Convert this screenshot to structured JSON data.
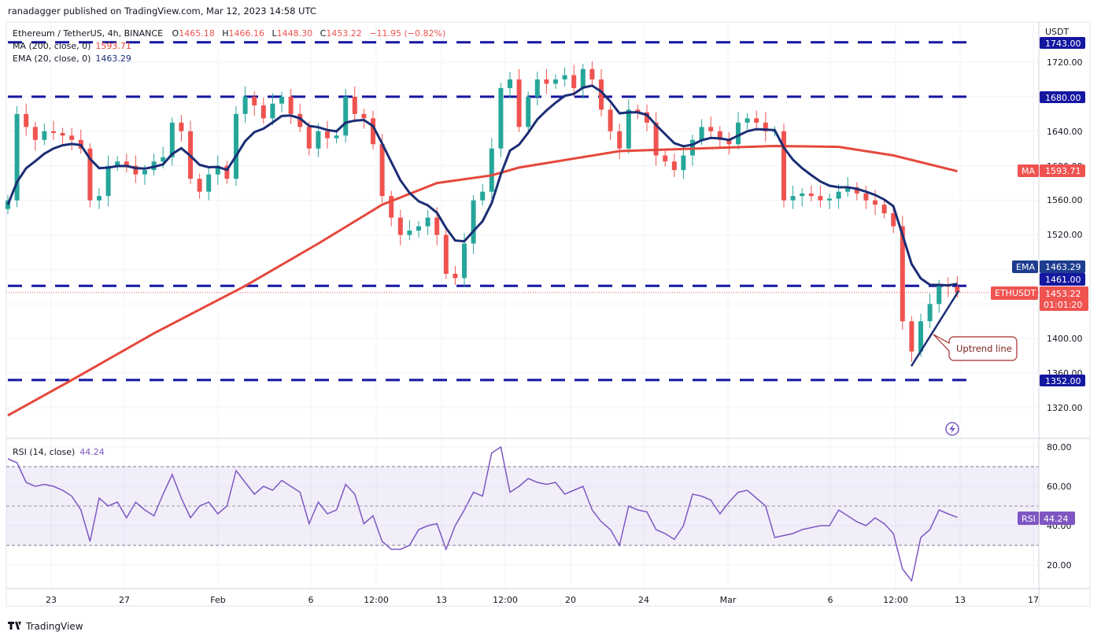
{
  "header": {
    "published": "ranadagger published on TradingView.com, Mar 12, 2023 14:58 UTC",
    "symbol": "Ethereum / TetherUS, 4h, BINANCE",
    "o_label": "O",
    "o": "1465.18",
    "h_label": "H",
    "h": "1466.16",
    "l_label": "L",
    "l": "1448.30",
    "c_label": "C",
    "c": "1453.22",
    "change": "−11.95 (−0.82%)",
    "ma_legend": "MA (200, close, 0)",
    "ma_value": "1593.71",
    "ema_legend": "EMA (20, close, 0)",
    "ema_value": "1463.29",
    "rsi_legend": "RSI (14, close)",
    "rsi_value": "44.24"
  },
  "price_axis": {
    "currency": "USDT",
    "ticks": [
      "1720.00",
      "1640.00",
      "1600.00",
      "1560.00",
      "1520.00",
      "1400.00",
      "1360.00",
      "1320.00"
    ],
    "badges": {
      "r1743": "1743.00",
      "r1680": "1680.00",
      "ma_tag": "MA",
      "ma": "1593.71",
      "ema_tag": "EMA",
      "ema": "1463.29",
      "r1461": "1461.00",
      "sym_tag": "ETHUSDT",
      "last": "1453.22",
      "countdown": "01:01:20",
      "r1352": "1352.00"
    }
  },
  "rsi_axis": {
    "ticks": [
      "80.00",
      "60.00",
      "40.00",
      "20.00"
    ],
    "tag": "RSI",
    "value": "44.24"
  },
  "time_axis": [
    "23",
    "27",
    "Feb",
    "6",
    "12:00",
    "13",
    "12:00",
    "20",
    "24",
    "Mar",
    "6",
    "12:00",
    "13",
    "17"
  ],
  "annotation": {
    "uptrend": "Uptrend line"
  },
  "footer": {
    "brand": "TradingView"
  },
  "colors": {
    "up": "#26a69a",
    "down": "#ef5350",
    "ma": "#e5483c",
    "ema": "#1b2e74",
    "level": "#1417a0",
    "rsi": "#7e57c2"
  },
  "chart_data": {
    "type": "candlestick",
    "title": "Ethereum / TetherUS, 4h, BINANCE",
    "sampling": "approx. 12h steps, Jan 20 to Mar 12 2023",
    "ylim": [
      1300,
      1760
    ],
    "horizontal_levels": [
      1743,
      1680,
      1461,
      1352
    ],
    "closes": [
      1560,
      1660,
      1645,
      1630,
      1640,
      1638,
      1635,
      1630,
      1620,
      1560,
      1565,
      1600,
      1605,
      1600,
      1590,
      1595,
      1605,
      1610,
      1650,
      1640,
      1585,
      1570,
      1590,
      1600,
      1585,
      1660,
      1680,
      1670,
      1655,
      1672,
      1680,
      1660,
      1645,
      1620,
      1640,
      1632,
      1635,
      1680,
      1660,
      1655,
      1625,
      1565,
      1540,
      1520,
      1525,
      1530,
      1540,
      1520,
      1475,
      1470,
      1510,
      1560,
      1570,
      1620,
      1690,
      1700,
      1645,
      1680,
      1700,
      1695,
      1700,
      1705,
      1690,
      1712,
      1700,
      1665,
      1640,
      1620,
      1665,
      1662,
      1650,
      1612,
      1605,
      1595,
      1612,
      1630,
      1645,
      1640,
      1630,
      1625,
      1650,
      1655,
      1650,
      1640,
      1640,
      1560,
      1565,
      1568,
      1565,
      1560,
      1562,
      1570,
      1575,
      1568,
      1560,
      1555,
      1545,
      1530,
      1420,
      1385,
      1420,
      1440,
      1462,
      1460,
      1453.22
    ],
    "ma200_keypoints": [
      [
        0,
        1311
      ],
      [
        7,
        1352
      ],
      [
        16,
        1406
      ],
      [
        26,
        1461
      ],
      [
        34,
        1510
      ],
      [
        41,
        1555
      ],
      [
        47,
        1580
      ],
      [
        53,
        1589
      ],
      [
        56,
        1598
      ],
      [
        67,
        1617
      ],
      [
        84,
        1623
      ],
      [
        91,
        1622
      ],
      [
        97,
        1612
      ],
      [
        104,
        1593.71
      ]
    ],
    "ema20_last": 1463.29,
    "rsi": {
      "ylim": [
        0,
        90
      ],
      "bands": [
        30,
        50,
        70
      ],
      "values": [
        74,
        72,
        62,
        60,
        61,
        60,
        58,
        55,
        48,
        32,
        54,
        50,
        52,
        44,
        52,
        48,
        45,
        56,
        66,
        54,
        44,
        50,
        52,
        46,
        50,
        68,
        62,
        56,
        60,
        58,
        63,
        60,
        57,
        41,
        52,
        46,
        48,
        61,
        56,
        41,
        45,
        32,
        28,
        28,
        30,
        38,
        40,
        41,
        28,
        40,
        48,
        57,
        55,
        77,
        80,
        57,
        60,
        64,
        62,
        61,
        62,
        56,
        58,
        60,
        48,
        42,
        38,
        30,
        50,
        48,
        47,
        38,
        36,
        33,
        40,
        56,
        55,
        53,
        46,
        52,
        57,
        58,
        54,
        50,
        34,
        35,
        36,
        38,
        39,
        40,
        40,
        48,
        45,
        42,
        40,
        44,
        41,
        36,
        18,
        12,
        34,
        38,
        48,
        46,
        44.24
      ]
    },
    "uptrend_line": {
      "from_price": 1368,
      "to_price": 1455
    }
  }
}
